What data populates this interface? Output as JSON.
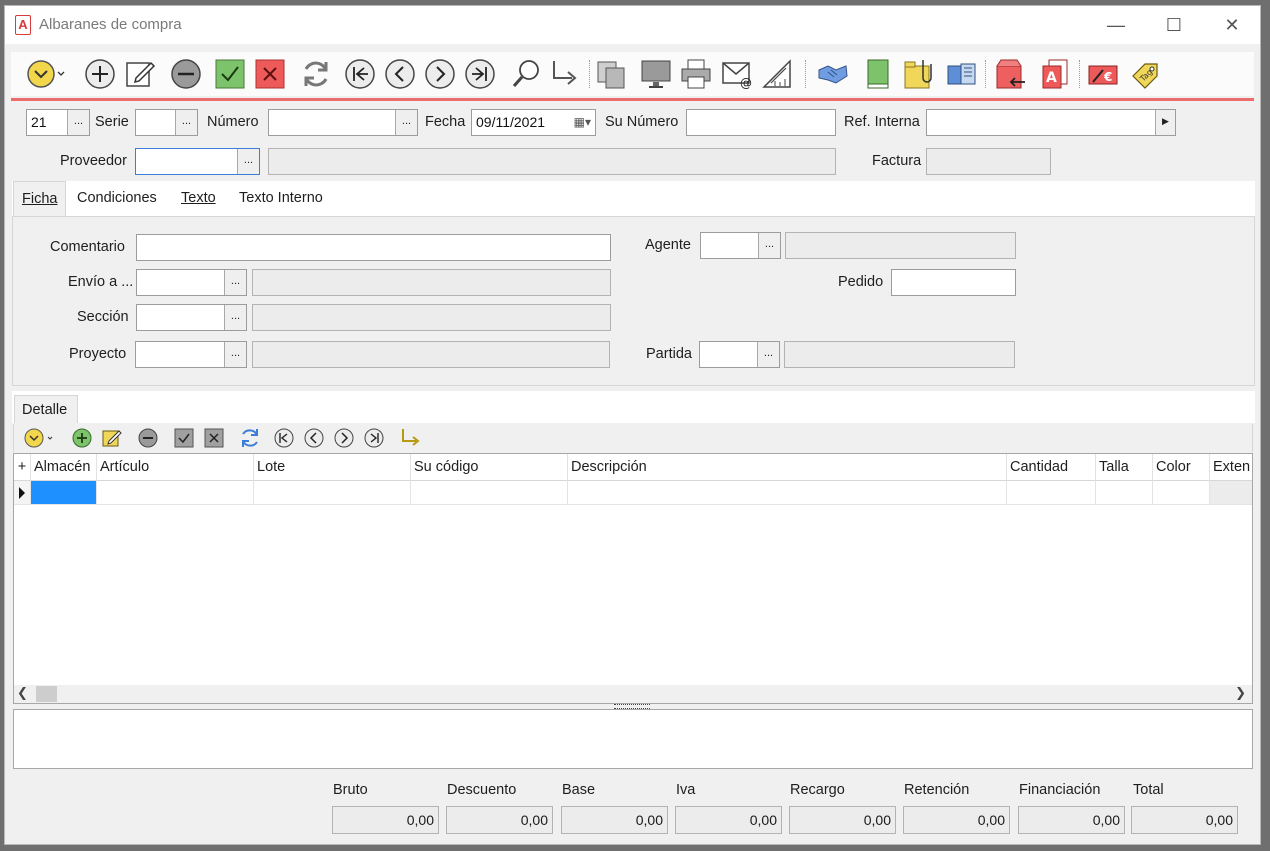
{
  "window": {
    "title": "Albaranes de compra"
  },
  "toolbar_icons": [
    "dropdown-menu-icon",
    "add-icon",
    "edit-icon",
    "delete-icon",
    "confirm-icon",
    "cancel-icon",
    "refresh-icon",
    "first-record-icon",
    "previous-record-icon",
    "next-record-icon",
    "last-record-icon",
    "search-icon",
    "goto-icon",
    "copy-icon",
    "screen-icon",
    "print-icon",
    "email-icon",
    "design-icon",
    "handshake-icon",
    "book-icon",
    "attachments-icon",
    "thermal-print-icon",
    "export-box-icon",
    "pdf-icon",
    "invoice-icon",
    "tag-icon"
  ],
  "header": {
    "serie_code": "21",
    "serie_label": "Serie",
    "numero_label": "Número",
    "fecha_label": "Fecha",
    "fecha_value": "09/11/2021",
    "su_numero_label": "Su Número",
    "ref_interna_label": "Ref. Interna",
    "proveedor_label": "Proveedor",
    "factura_label": "Factura",
    "dots": "..."
  },
  "tabs": [
    "Ficha",
    "Condiciones",
    "Texto",
    "Texto Interno"
  ],
  "ficha": {
    "comentario_label": "Comentario",
    "envio_label": "Envío a ...",
    "seccion_label": "Sección",
    "proyecto_label": "Proyecto",
    "agente_label": "Agente",
    "pedido_label": "Pedido",
    "partida_label": "Partida"
  },
  "detail": {
    "tab_label": "Detalle",
    "add_col": "+",
    "columns": [
      "Almacén",
      "Artículo",
      "Lote",
      "Su código",
      "Descripción",
      "Cantidad",
      "Talla",
      "Color",
      "Exten"
    ]
  },
  "totals": {
    "labels": [
      "Bruto",
      "Descuento",
      "Base",
      "Iva",
      "Recargo",
      "Retención",
      "Financiación",
      "Total"
    ],
    "values": [
      "0,00",
      "0,00",
      "0,00",
      "0,00",
      "0,00",
      "0,00",
      "0,00",
      "0,00"
    ]
  },
  "colors": {
    "accent_line": "#ec6b6b",
    "confirm": "#7cc36b",
    "cancel": "#ee5a5a",
    "selected_cell": "#1e90ff"
  }
}
